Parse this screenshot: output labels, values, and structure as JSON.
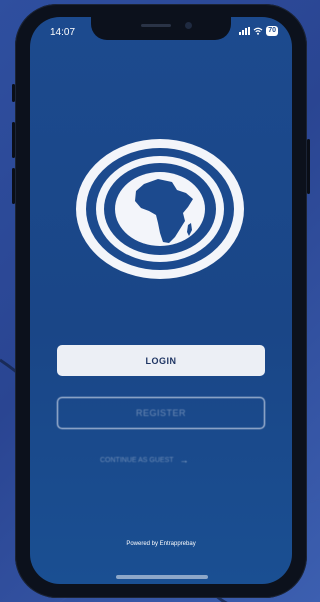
{
  "status_bar": {
    "time": "14:07",
    "battery": "70",
    "icons": [
      "signal-icon",
      "wifi-icon",
      "battery-icon"
    ]
  },
  "logo": {
    "icon": "africa-map-icon"
  },
  "buttons": {
    "login_label": "LOGIN",
    "register_label": "REGISTER"
  },
  "guest": {
    "label": "CONTINUE AS GUEST",
    "icon": "arrow-right-icon"
  },
  "footer": {
    "powered_by": "Powered by Entrapprebay"
  },
  "colors": {
    "screen_background": "#1c4a8e",
    "button_light": "#eceff5",
    "button_text": "#1f3563",
    "outer_background": "#2f4f9f"
  }
}
